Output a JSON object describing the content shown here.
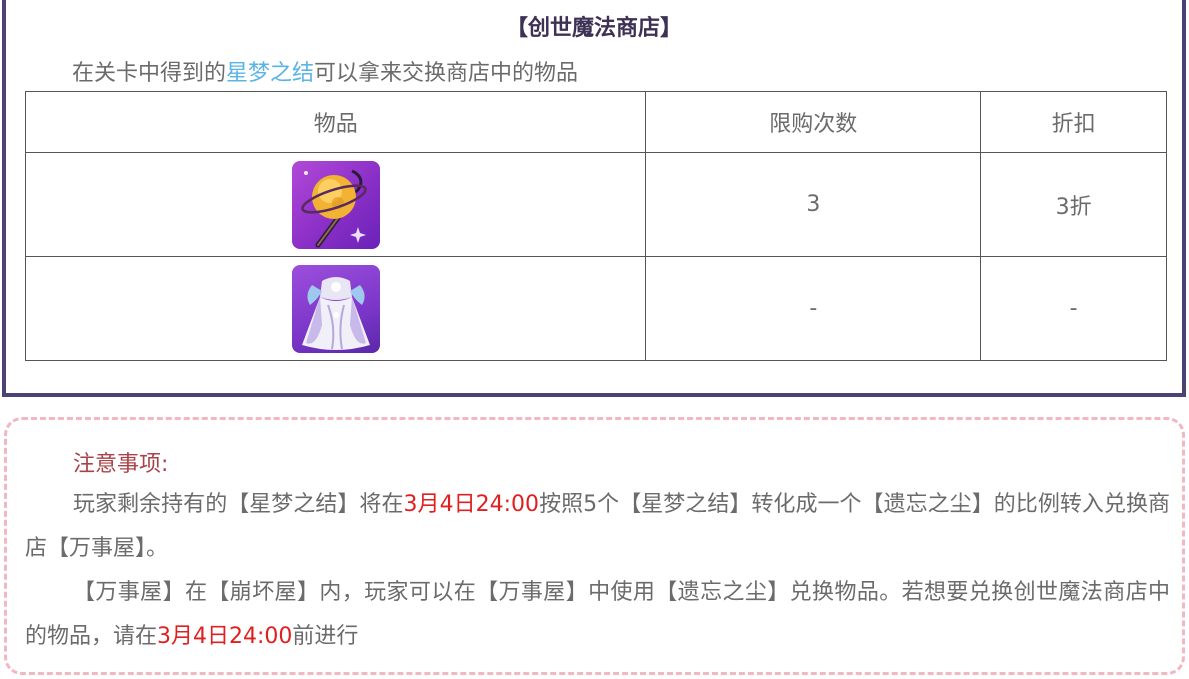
{
  "shop": {
    "title": "【创世魔法商店】",
    "intro_prefix": "在关卡中得到的",
    "intro_highlight": "星梦之结",
    "intro_suffix": "可以拿来交换商店中的物品",
    "table": {
      "headers": [
        "物品",
        "限购次数",
        "折扣"
      ],
      "rows": [
        {
          "icon": "golden-orb-staff-icon",
          "limit": "3",
          "discount": "3折"
        },
        {
          "icon": "lavender-dress-icon",
          "limit": "-",
          "discount": "-"
        }
      ]
    }
  },
  "notice": {
    "title": "注意事项:",
    "p1_a": "玩家剩余持有的【星梦之结】将在",
    "p1_date": "3月4日24:00",
    "p1_b": "按照5个【星梦之结】转化成一个【遗忘之尘】的比例转入兑换商店【万事屋】。",
    "p2_a": "【万事屋】在【崩坏屋】内，玩家可以在【万事屋】中使用【遗忘之尘】兑换物品。若想要兑换创世魔法商店中的物品，请在",
    "p2_date": "3月4日24:00",
    "p2_b": "前进行"
  },
  "colors": {
    "frame": "#4e4173",
    "highlight": "#5ab4e6",
    "date_red": "#e02020",
    "notice_border": "#f2b7c1",
    "notice_title": "#a84349"
  }
}
